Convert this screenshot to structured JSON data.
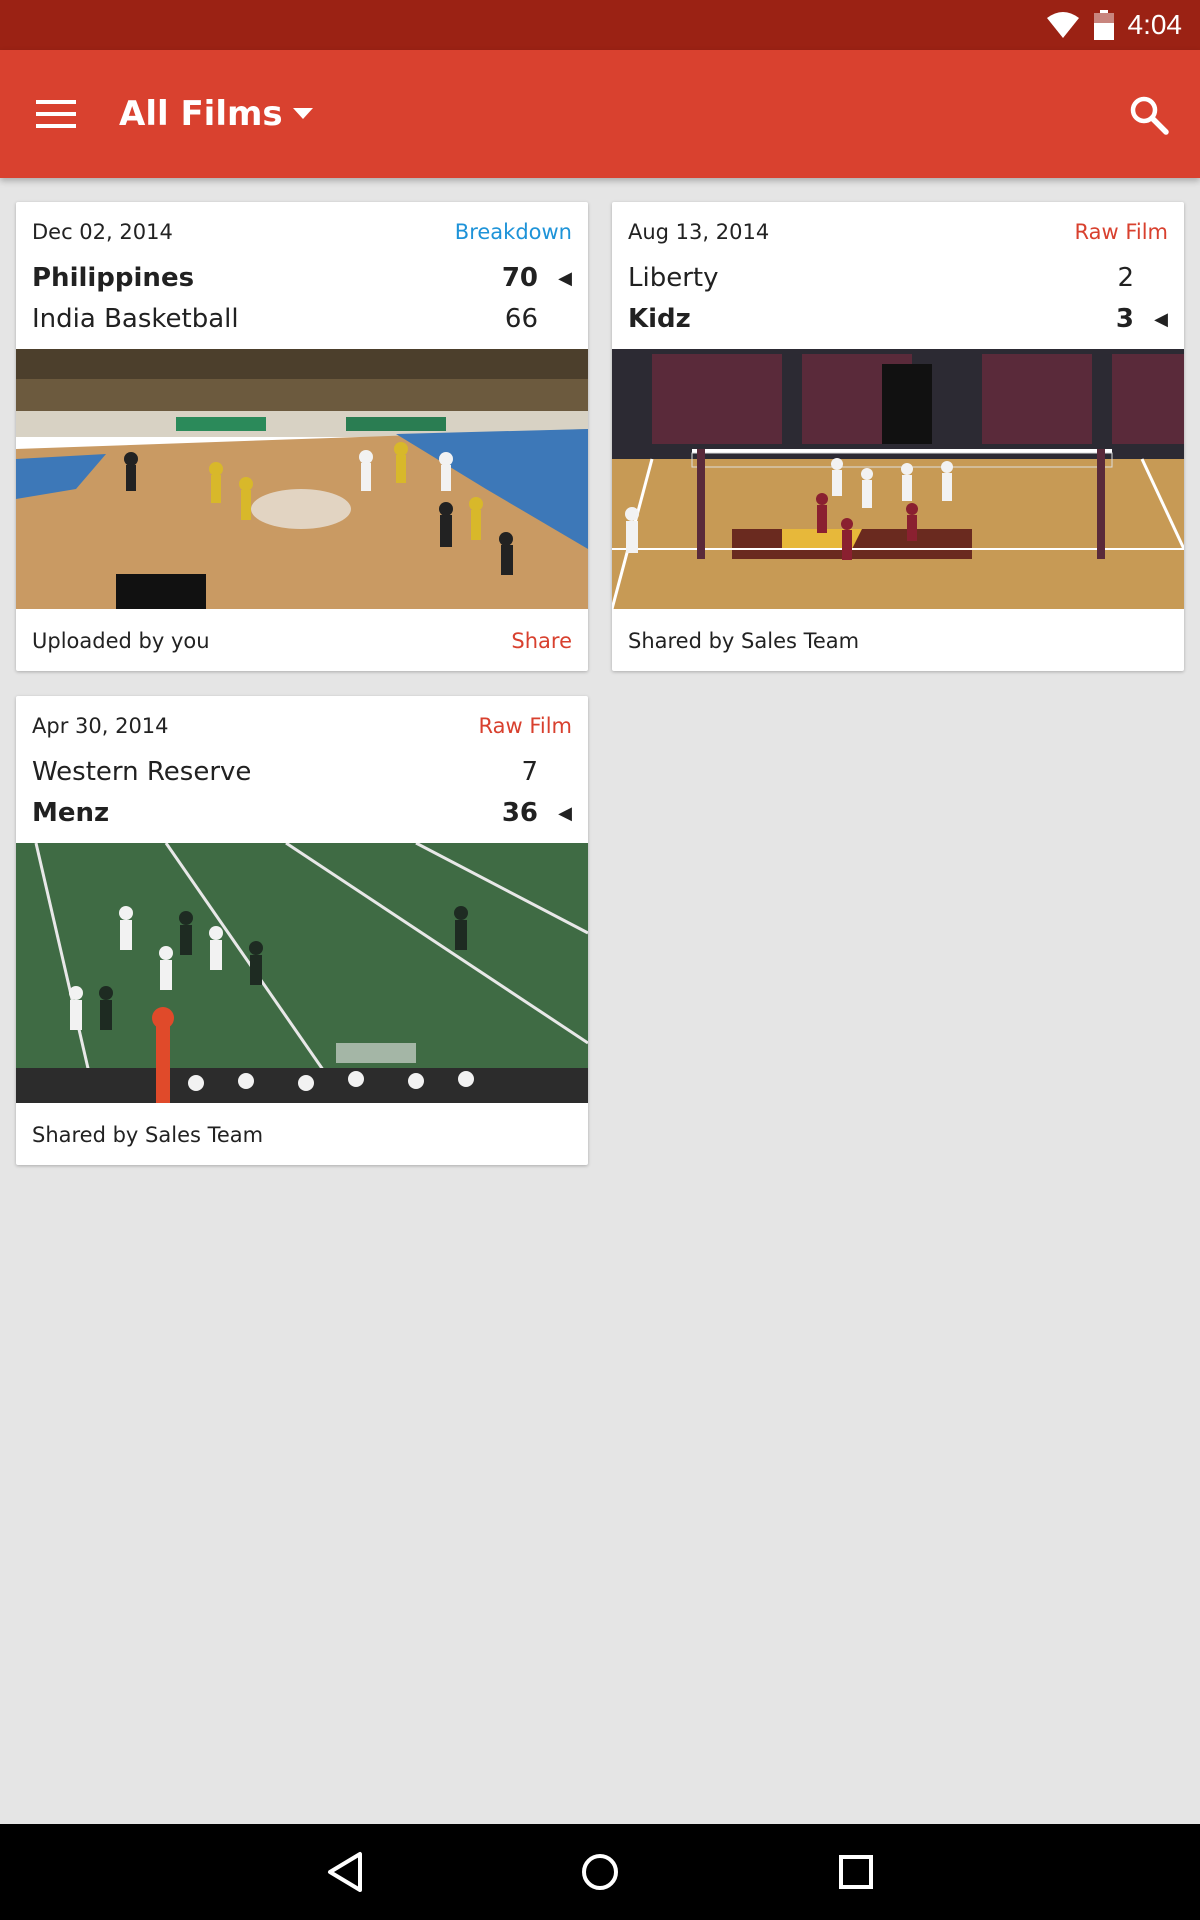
{
  "status_bar": {
    "time": "4:04",
    "wifi_icon": "wifi-icon",
    "battery_icon": "battery-icon"
  },
  "app_bar": {
    "title": "All Films",
    "menu_icon": "hamburger-menu-icon",
    "dropdown_icon": "caret-down-icon",
    "search_icon": "search-icon",
    "color": "#d9412f",
    "status_color": "#9b2214"
  },
  "films": [
    {
      "date": "Dec 02, 2014",
      "type": "Breakdown",
      "type_color": "#1e93d8",
      "team1": {
        "name": "Philippines",
        "score": "70",
        "winner": true
      },
      "team2": {
        "name": "India Basketball",
        "score": "66",
        "winner": false
      },
      "owner": "Uploaded by you",
      "action": "Share",
      "thumbnail": "basketball-game-thumbnail"
    },
    {
      "date": "Aug 13, 2014",
      "type": "Raw Film",
      "type_color": "#d8402e",
      "team1": {
        "name": "Liberty",
        "score": "2",
        "winner": false
      },
      "team2": {
        "name": "Kidz",
        "score": "3",
        "winner": true
      },
      "owner": "Shared by Sales Team",
      "thumbnail": "volleyball-game-thumbnail"
    },
    {
      "date": "Apr 30, 2014",
      "type": "Raw Film",
      "type_color": "#d8402e",
      "team1": {
        "name": "Western Reserve",
        "score": "7",
        "winner": false
      },
      "team2": {
        "name": "Menz",
        "score": "36",
        "winner": true
      },
      "owner": "Shared by Sales Team",
      "thumbnail": "football-game-thumbnail"
    }
  ],
  "nav_bar": {
    "back_icon": "back-triangle-icon",
    "home_icon": "home-circle-icon",
    "recents_icon": "recents-square-icon"
  }
}
